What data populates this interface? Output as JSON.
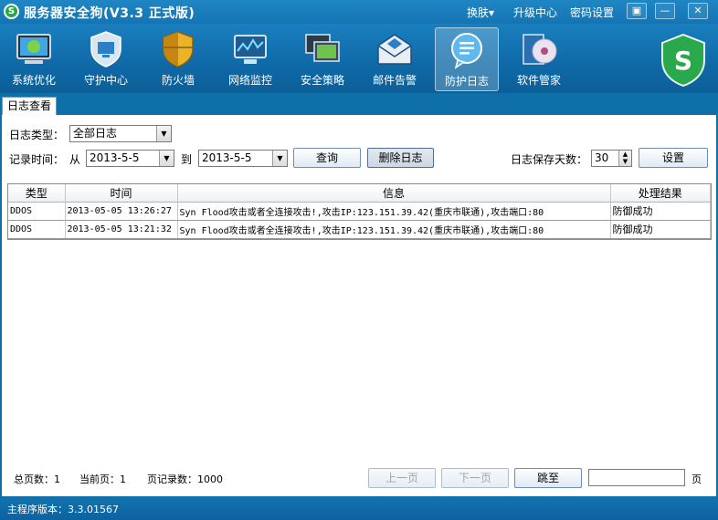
{
  "window": {
    "title": "服务器安全狗(V3.3 正式版)",
    "logo_icon": "s-shield-icon"
  },
  "top_links": {
    "skin": "换肤▾",
    "upgrade": "升级中心",
    "password": "密码设置"
  },
  "window_buttons": {
    "menu": "▣",
    "minimize": "—",
    "close": "✕"
  },
  "toolbar": [
    {
      "id": "system-optimize",
      "label": "系统优化",
      "icon": "monitor-icon"
    },
    {
      "id": "guard-center",
      "label": "守护中心",
      "icon": "shield-monitor-icon"
    },
    {
      "id": "firewall",
      "label": "防火墙",
      "icon": "shield-icon"
    },
    {
      "id": "network-monitor",
      "label": "网络监控",
      "icon": "network-monitor-icon"
    },
    {
      "id": "security-policy",
      "label": "安全策略",
      "icon": "screens-icon"
    },
    {
      "id": "mail-alert",
      "label": "邮件告警",
      "icon": "envelope-icon"
    },
    {
      "id": "protect-log",
      "label": "防护日志",
      "icon": "chat-bubble-icon",
      "active": true
    },
    {
      "id": "software-manager",
      "label": "软件管家",
      "icon": "disc-box-icon"
    }
  ],
  "tab": {
    "label": "日志查看"
  },
  "filters": {
    "type_label": "日志类型：",
    "type_value": "全部日志",
    "time_label": "记录时间：",
    "from_label": "从",
    "from_value": "2013-5-5",
    "to_label": "到",
    "to_value": "2013-5-5",
    "query_button": "查询",
    "delete_button": "删除日志",
    "keep_days_label": "日志保存天数：",
    "keep_days_value": "30",
    "set_button": "设置"
  },
  "table": {
    "columns": [
      "类型",
      "时间",
      "信息",
      "处理结果"
    ],
    "rows": [
      {
        "type": "DDOS",
        "time": "2013-05-05 13:26:27",
        "info": "Syn Flood攻击或者全连接攻击!,攻击IP:123.151.39.42(重庆市联通),攻击端口:80",
        "result": "防御成功"
      },
      {
        "type": "DDOS",
        "time": "2013-05-05 13:21:32",
        "info": "Syn Flood攻击或者全连接攻击!,攻击IP:123.151.39.42(重庆市联通),攻击端口:80",
        "result": "防御成功"
      }
    ]
  },
  "pager": {
    "total_pages": "总页数：1",
    "current_page": "当前页：1",
    "page_records": "页记录数：1000",
    "prev": "上一页",
    "next": "下一页",
    "jump": "跳至",
    "page_suffix": "页"
  },
  "status": {
    "version": "主程序版本：3.3.01567"
  },
  "colors": {
    "chrome": "#0f6fa8",
    "brand_green": "#27a84a"
  }
}
